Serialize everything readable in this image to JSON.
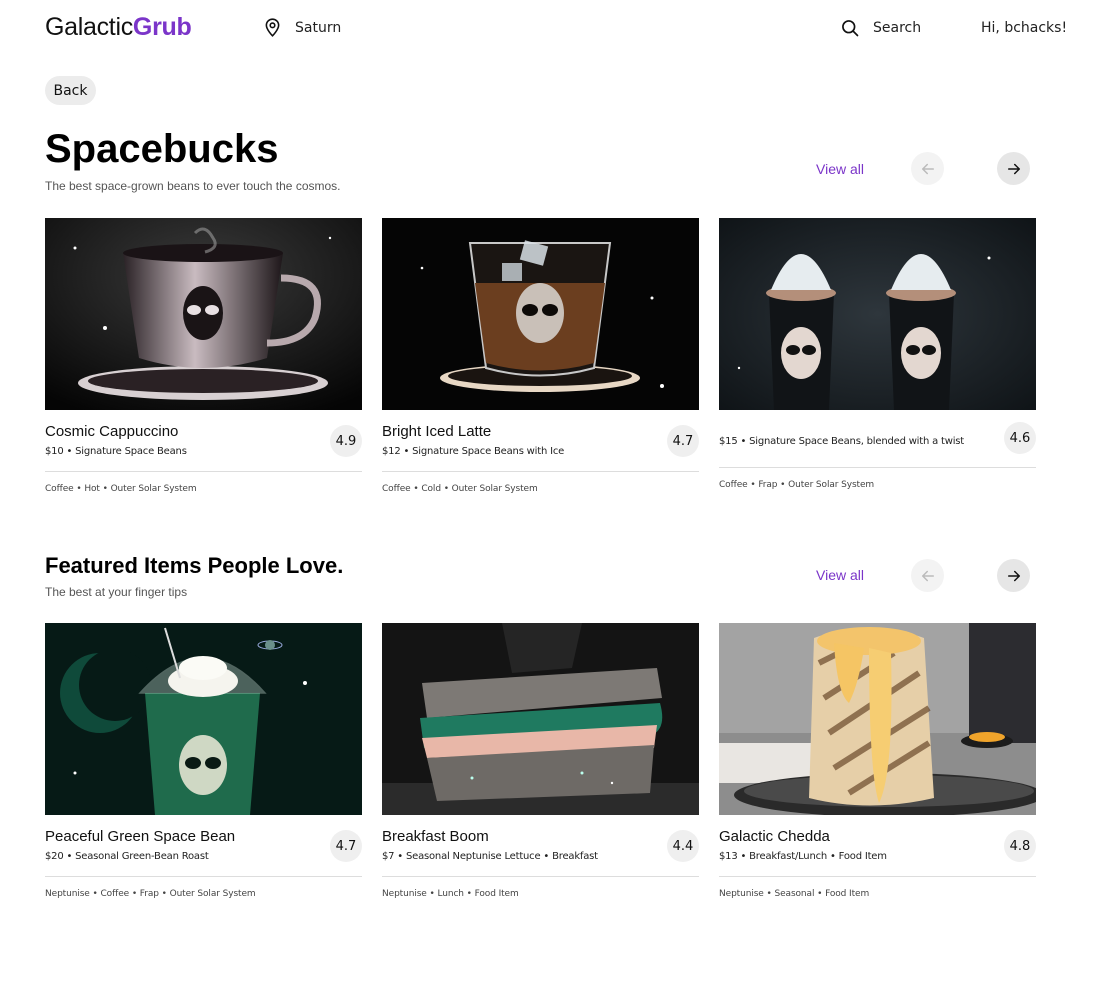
{
  "header": {
    "logo_main": "Galactic",
    "logo_accent": "Grub",
    "location": "Saturn",
    "search_label": "Search",
    "greeting": "Hi, bchacks!"
  },
  "back_label": "Back",
  "accent_color": "#7b35c9",
  "sections": [
    {
      "title": "Spacebucks",
      "subtitle": "The best space-grown beans to ever touch the cosmos.",
      "view_all": "View all",
      "items": [
        {
          "name": "Cosmic Cappuccino",
          "detail": "$10 • Signature Space Beans",
          "rating": "4.9",
          "tags": "Coffee • Hot • Outer Solar System"
        },
        {
          "name": "Bright Iced Latte",
          "detail": "$12 • Signature Space Beans with Ice",
          "rating": "4.7",
          "tags": "Coffee • Cold • Outer Solar System"
        },
        {
          "name": "",
          "detail": "$15 • Signature Space Beans, blended with a twist",
          "rating": "4.6",
          "tags": "Coffee • Frap • Outer Solar System"
        }
      ]
    },
    {
      "title": "Featured Items People Love.",
      "subtitle": "The best at your finger tips",
      "view_all": "View all",
      "items": [
        {
          "name": "Peaceful Green Space Bean",
          "detail": "$20 • Seasonal Green-Bean Roast",
          "rating": "4.7",
          "tags": "Neptunise • Coffee • Frap • Outer Solar System"
        },
        {
          "name": "Breakfast Boom",
          "detail": "$7 • Seasonal Neptunise Lettuce • Breakfast",
          "rating": "4.4",
          "tags": "Neptunise • Lunch • Food Item"
        },
        {
          "name": "Galactic Chedda",
          "detail": "$13 • Breakfast/Lunch • Food Item",
          "rating": "4.8",
          "tags": "Neptunise • Seasonal • Food Item"
        }
      ]
    }
  ]
}
